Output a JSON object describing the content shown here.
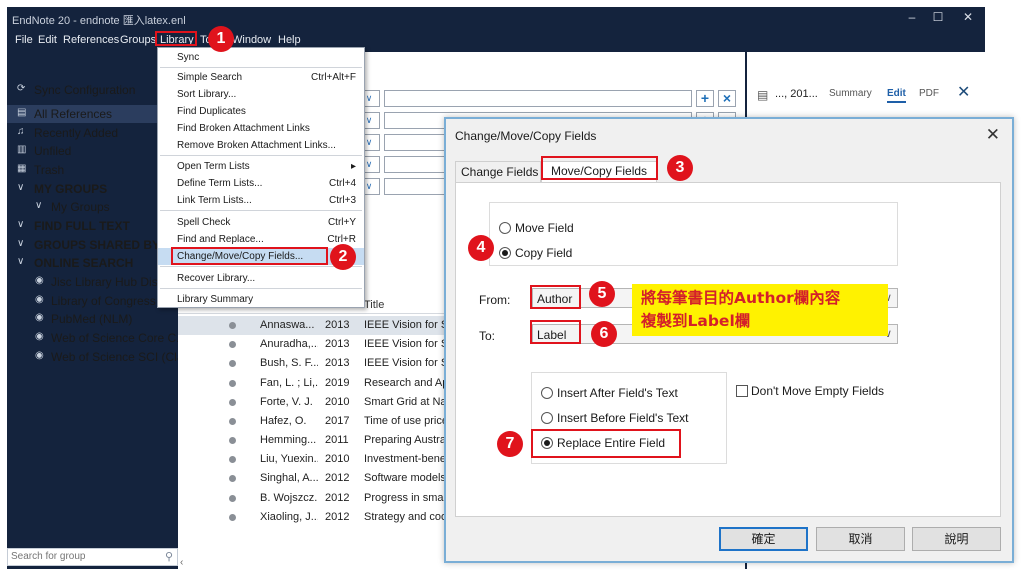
{
  "window": {
    "title": "EndNote 20 - endnote 匯入latex.enl",
    "min": "–",
    "max": "☐",
    "close": "✕"
  },
  "menubar": [
    "File",
    "Edit",
    "References",
    "Groups",
    "Library",
    "Tools",
    "Window",
    "Help"
  ],
  "sidebar": {
    "sync": "Sync Configuration",
    "all_references": "All References",
    "recently_added": "Recently Added",
    "unfiled": "Unfiled",
    "trash": "Trash",
    "my_groups_header": "MY GROUPS",
    "my_groups": "My Groups",
    "find_full_text": "FIND FULL TEXT",
    "groups_shared": "GROUPS SHARED BY O...",
    "online_search": "ONLINE SEARCH",
    "online_items": [
      "Jisc Library Hub Discove",
      "Library of Congress",
      "PubMed (NLM)",
      "Web of Science Core C...",
      "Web of Science SCI (Cla..."
    ],
    "search_placeholder": "Search for group"
  },
  "library_menu": {
    "items": [
      {
        "label": "Sync",
        "shortcut": ""
      },
      {
        "label": "Simple Search",
        "shortcut": "Ctrl+Alt+F"
      },
      {
        "label": "Sort Library...",
        "shortcut": ""
      },
      {
        "label": "Find Duplicates",
        "shortcut": ""
      },
      {
        "label": "Find Broken Attachment Links",
        "shortcut": ""
      },
      {
        "label": "Remove Broken Attachment Links...",
        "shortcut": ""
      },
      {
        "label": "Open Term Lists",
        "shortcut": "▸"
      },
      {
        "label": "Define Term Lists...",
        "shortcut": "Ctrl+4"
      },
      {
        "label": "Link Term Lists...",
        "shortcut": "Ctrl+3"
      },
      {
        "label": "Spell Check",
        "shortcut": "Ctrl+Y"
      },
      {
        "label": "Find and Replace...",
        "shortcut": "Ctrl+R"
      },
      {
        "label": "Change/Move/Copy Fields...",
        "shortcut": ""
      },
      {
        "label": "Recover Library...",
        "shortcut": ""
      },
      {
        "label": "Library Summary",
        "shortcut": ""
      }
    ]
  },
  "table": {
    "title_header": "Title",
    "rows": [
      {
        "author": "Annaswa...",
        "year": "2013",
        "title": "IEEE Vision for Sm"
      },
      {
        "author": "Anuradha,...",
        "year": "2013",
        "title": "IEEE Vision for Sm"
      },
      {
        "author": "Bush, S. F....",
        "year": "2013",
        "title": "IEEE Vision for Sm"
      },
      {
        "author": "Fan, L. ; Li,...",
        "year": "2019",
        "title": "Research and App"
      },
      {
        "author": "Forte, V. J.",
        "year": "2010",
        "title": "Smart Grid at Nat"
      },
      {
        "author": "Hafez, O.",
        "year": "2017",
        "title": "Time of use price"
      },
      {
        "author": "Hemming...",
        "year": "2011",
        "title": "Preparing Austral"
      },
      {
        "author": "Liu, Yuexin...",
        "year": "2010",
        "title": "Investment-benef"
      },
      {
        "author": "Singhal, A...",
        "year": "2012",
        "title": "Software models"
      },
      {
        "author": "B. Wojszcz...",
        "year": "2012",
        "title": "Progress in smart"
      },
      {
        "author": "Xiaoling, J...",
        "year": "2012",
        "title": "Strategy and coo"
      }
    ]
  },
  "right_pane": {
    "ref": "..., 201...",
    "summary": "Summary",
    "edit": "Edit",
    "pdf": "PDF"
  },
  "dialog": {
    "title": "Change/Move/Copy Fields",
    "tab_change": "Change Fields",
    "tab_move": "Move/Copy Fields",
    "move_field": "Move Field",
    "copy_field": "Copy Field",
    "from_label": "From:",
    "from_value": "Author",
    "to_label": "To:",
    "to_value": "Label",
    "insert_after": "Insert After Field's Text",
    "insert_before": "Insert Before Field's Text",
    "replace_entire": "Replace Entire Field",
    "dont_move_empty": "Don't Move Empty Fields",
    "ok": "確定",
    "cancel": "取消",
    "help": "說明"
  },
  "callout": {
    "line1": "將每筆書目的Author欄內容",
    "line2": "複製到Label欄"
  },
  "badges": [
    "1",
    "2",
    "3",
    "4",
    "5",
    "6",
    "7"
  ],
  "colors": {
    "navy": "#14233d",
    "red": "#e0131c",
    "yellow": "#fff200",
    "accent": "#1e73c8"
  }
}
